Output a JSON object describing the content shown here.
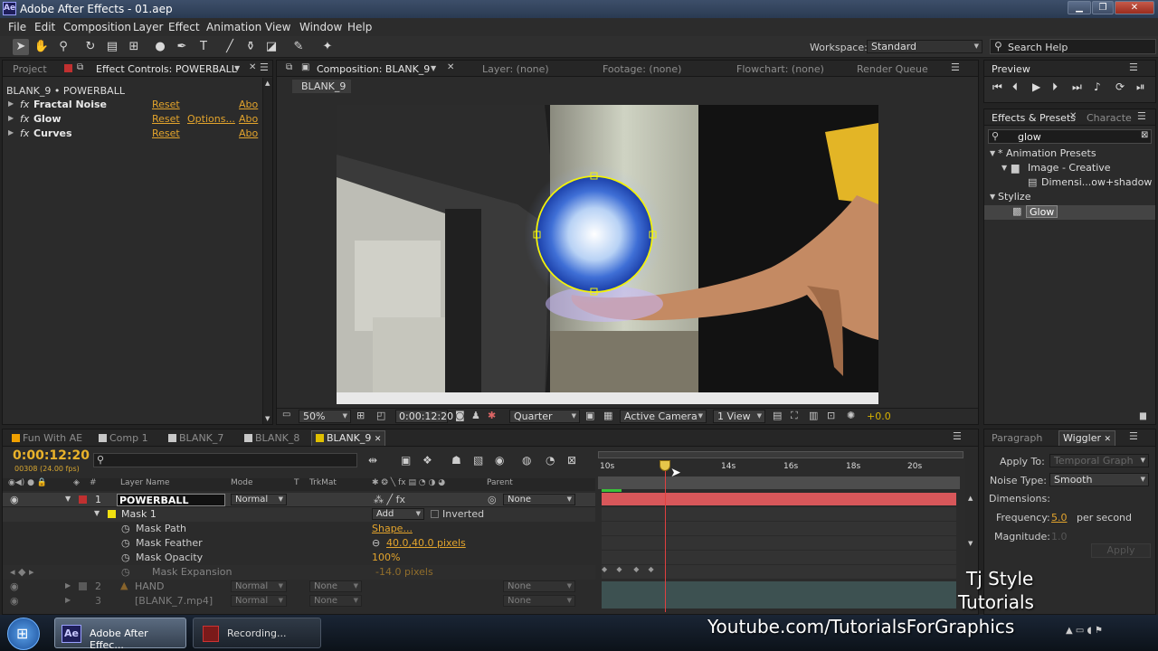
{
  "window": {
    "title": "Adobe After Effects - 01.aep",
    "app_icon": "Ae"
  },
  "menu": [
    "File",
    "Edit",
    "Composition",
    "Layer",
    "Effect",
    "Animation",
    "View",
    "Window",
    "Help"
  ],
  "workspace": {
    "label": "Workspace:",
    "value": "Standard"
  },
  "search_help": "Search Help",
  "project_panel": {
    "tab_project": "Project",
    "tab_effect_controls": "Effect Controls: POWERBALL",
    "layer_path": "BLANK_9 • POWERBALL",
    "effects": [
      {
        "name": "Fractal Noise",
        "reset": "Reset",
        "about": "Abo"
      },
      {
        "name": "Glow",
        "reset": "Reset",
        "options": "Options...",
        "about": "Abo"
      },
      {
        "name": "Curves",
        "reset": "Reset",
        "about": "Abo"
      }
    ]
  },
  "comp_panel": {
    "tab_comp": "Composition: BLANK_9",
    "tab_layer": "Layer: (none)",
    "tab_footage": "Footage: (none)",
    "tab_flowchart": "Flowchart: (none)",
    "tab_render": "Render Queue",
    "comp_name": "BLANK_9",
    "zoom": "50%",
    "timecode": "0:00:12:20",
    "resolution": "Quarter",
    "camera": "Active Camera",
    "view": "1 View",
    "exposure": "+0.0"
  },
  "preview": {
    "title": "Preview"
  },
  "effects_presets": {
    "tab": "Effects & Presets",
    "tab2": "Characte",
    "search": "glow",
    "tree": [
      {
        "label": "* Animation Presets",
        "level": 0
      },
      {
        "label": "Image - Creative",
        "level": 1
      },
      {
        "label": "Dimensi...ow+shadow",
        "level": 2
      },
      {
        "label": "Stylize",
        "level": 0
      },
      {
        "label": "Glow",
        "level": 1,
        "selected": true
      }
    ]
  },
  "timeline": {
    "tabs": [
      "Fun With AE",
      "Comp 1",
      "BLANK_7",
      "BLANK_8",
      "BLANK_9"
    ],
    "tab_colors": [
      "#f0a000",
      "#c8c8c8",
      "#c8c8c8",
      "#c8c8c8",
      "#e0c000"
    ],
    "timecode": "0:00:12:20",
    "frame_info": "00308 (24.00 fps)",
    "columns": {
      "layer_name": "Layer Name",
      "mode": "Mode",
      "t": "T",
      "trkmat": "TrkMat",
      "parent": "Parent"
    },
    "layers": [
      {
        "num": "1",
        "name": "POWERBALL",
        "mode": "Normal",
        "parent": "None"
      },
      {
        "num": "2",
        "name": "HAND",
        "mode": "Normal",
        "trkmat": "None",
        "parent": "None"
      },
      {
        "num": "3",
        "name": "[BLANK_7.mp4]",
        "mode": "Normal",
        "trkmat": "None",
        "parent": "None"
      }
    ],
    "mask": {
      "name": "Mask 1",
      "mode": "Add",
      "inverted": "Inverted",
      "props": [
        {
          "name": "Mask Path",
          "value": "Shape..."
        },
        {
          "name": "Mask Feather",
          "value": "40.0,40.0 pixels"
        },
        {
          "name": "Mask Opacity",
          "value": "100%"
        },
        {
          "name": "Mask Expansion",
          "value": "-14.0 pixels"
        }
      ]
    },
    "ruler": [
      "10s",
      "14s",
      "16s",
      "18s",
      "20s"
    ]
  },
  "wiggler": {
    "tab_paragraph": "Paragraph",
    "tab_wiggler": "Wiggler",
    "apply_to_label": "Apply To:",
    "apply_to": "Temporal Graph",
    "noise_type_label": "Noise Type:",
    "noise_type": "Smooth",
    "dimensions_label": "Dimensions:",
    "frequency_label": "Frequency:",
    "frequency": "5.0",
    "frequency_unit": "per second",
    "magnitude_label": "Magnitude:",
    "magnitude": "1.0",
    "apply": "Apply"
  },
  "watermark": {
    "line1": "Tj Style",
    "line2": "Tutorials",
    "url": "Youtube.com/TutorialsForGraphics"
  },
  "taskbar": {
    "items": [
      "Adobe After Effec...",
      "Recording..."
    ]
  }
}
